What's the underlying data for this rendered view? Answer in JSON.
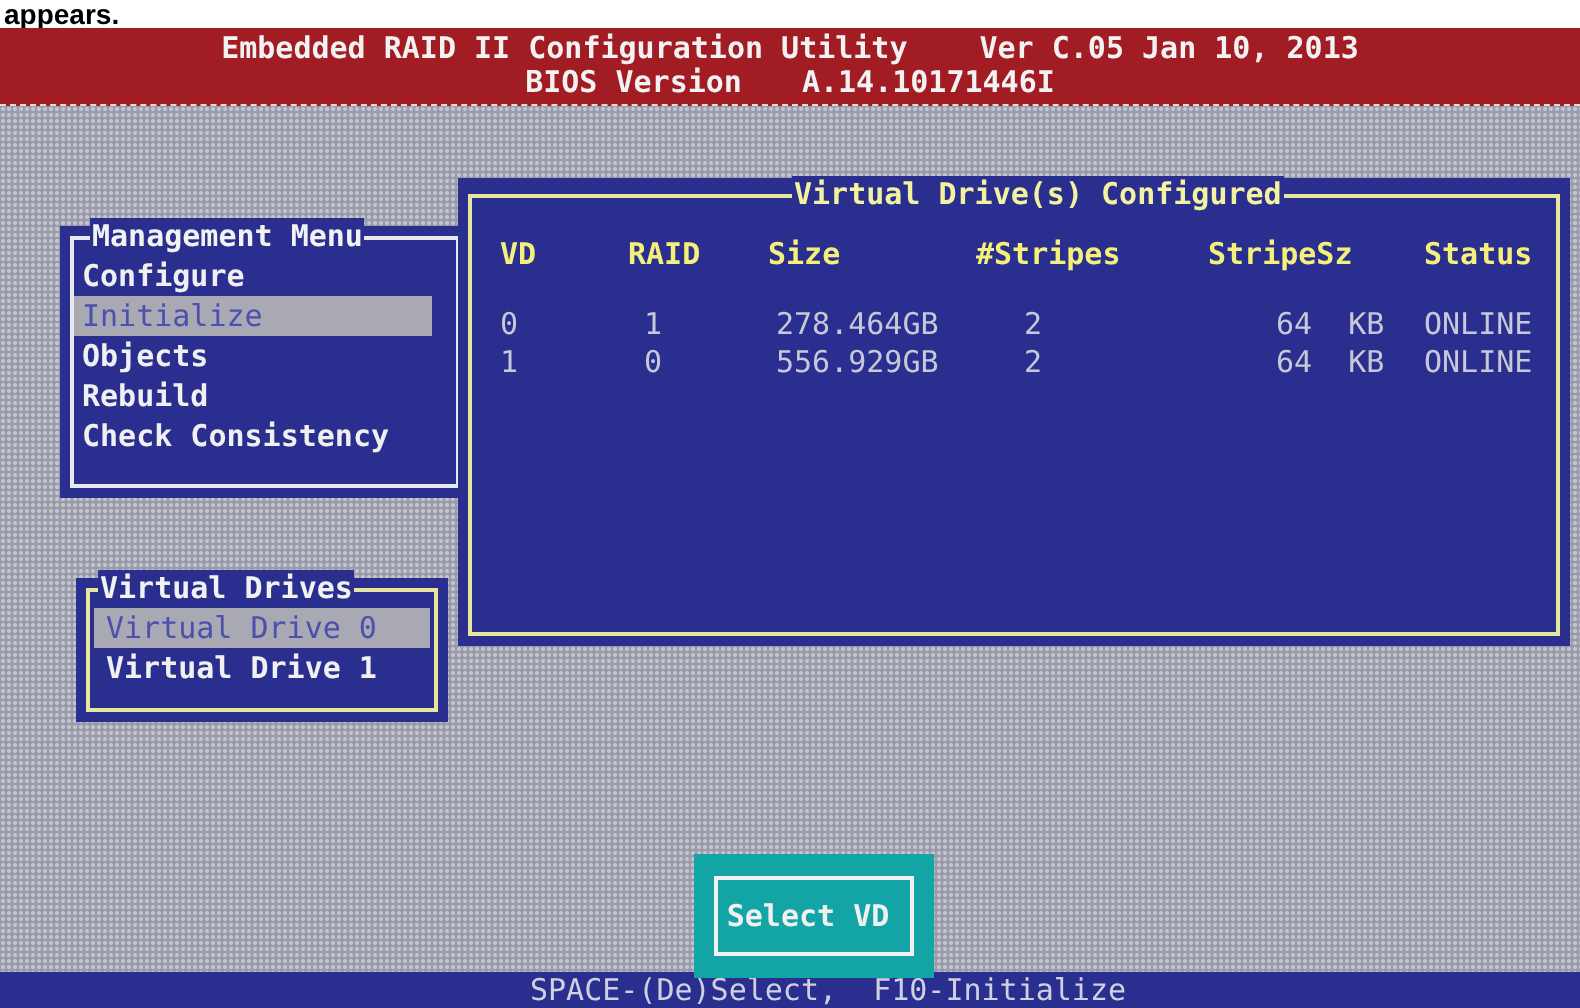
{
  "page_text": "appears.",
  "header": {
    "title": "Embedded RAID II Configuration Utility",
    "version": "Ver C.05 Jan 10, 2013",
    "bios_label": "BIOS Version",
    "bios_version": "A.14.10171446I"
  },
  "management_menu": {
    "title": "Management Menu",
    "items": [
      {
        "label": "Configure",
        "selected": false
      },
      {
        "label": "Initialize",
        "selected": true
      },
      {
        "label": "Objects",
        "selected": false
      },
      {
        "label": "Rebuild",
        "selected": false
      },
      {
        "label": "Check Consistency",
        "selected": false
      }
    ]
  },
  "configured_panel": {
    "title": "Virtual Drive(s) Configured",
    "columns": [
      "VD",
      "RAID",
      "Size",
      "#Stripes",
      "StripeSz",
      "Status"
    ],
    "rows": [
      [
        "0",
        "1",
        "278.464GB",
        "2",
        "64  KB",
        "ONLINE"
      ],
      [
        "1",
        "0",
        "556.929GB",
        "2",
        "64  KB",
        "ONLINE"
      ]
    ]
  },
  "virtual_drives": {
    "title": "Virtual Drives",
    "items": [
      {
        "label": "Virtual Drive 0",
        "selected": true
      },
      {
        "label": "Virtual Drive 1",
        "selected": false
      }
    ]
  },
  "dialog_button": "Select VD",
  "status_bar": "SPACE-(De)Select,  F10-Initialize"
}
